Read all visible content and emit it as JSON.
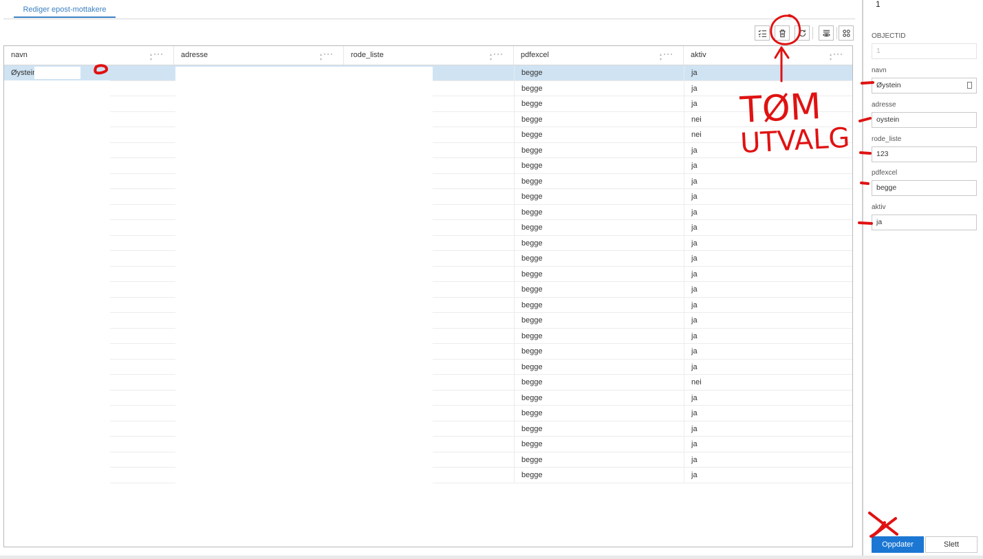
{
  "tab": {
    "label": "Rediger epost-mottakere"
  },
  "table": {
    "columns": [
      {
        "key": "navn",
        "label": "navn"
      },
      {
        "key": "adresse",
        "label": "adresse"
      },
      {
        "key": "rode_liste",
        "label": "rode_liste"
      },
      {
        "key": "pdfexcel",
        "label": "pdfexcel"
      },
      {
        "key": "aktiv",
        "label": "aktiv"
      }
    ],
    "rows": [
      {
        "navn": "Øystein",
        "pdfexcel": "begge",
        "aktiv": "ja"
      },
      {
        "navn": "",
        "pdfexcel": "begge",
        "aktiv": "ja"
      },
      {
        "navn": "",
        "pdfexcel": "begge",
        "aktiv": "ja"
      },
      {
        "navn": "",
        "pdfexcel": "begge",
        "aktiv": "nei"
      },
      {
        "navn": "",
        "pdfexcel": "begge",
        "aktiv": "nei"
      },
      {
        "navn": "",
        "pdfexcel": "begge",
        "aktiv": "ja"
      },
      {
        "navn": "",
        "pdfexcel": "begge",
        "aktiv": "ja"
      },
      {
        "navn": "",
        "pdfexcel": "begge",
        "aktiv": "ja"
      },
      {
        "navn": "",
        "pdfexcel": "begge",
        "aktiv": "ja"
      },
      {
        "navn": "",
        "pdfexcel": "begge",
        "aktiv": "ja"
      },
      {
        "navn": "",
        "pdfexcel": "begge",
        "aktiv": "ja"
      },
      {
        "navn": "",
        "pdfexcel": "begge",
        "aktiv": "ja"
      },
      {
        "navn": "",
        "pdfexcel": "begge",
        "aktiv": "ja"
      },
      {
        "navn": "",
        "pdfexcel": "begge",
        "aktiv": "ja"
      },
      {
        "navn": "",
        "pdfexcel": "begge",
        "aktiv": "ja"
      },
      {
        "navn": "",
        "pdfexcel": "begge",
        "aktiv": "ja"
      },
      {
        "navn": "",
        "pdfexcel": "begge",
        "aktiv": "ja"
      },
      {
        "navn": "",
        "pdfexcel": "begge",
        "aktiv": "ja"
      },
      {
        "navn": "",
        "pdfexcel": "begge",
        "aktiv": "ja"
      },
      {
        "navn": "",
        "pdfexcel": "begge",
        "aktiv": "ja"
      },
      {
        "navn": "",
        "pdfexcel": "begge",
        "aktiv": "nei"
      },
      {
        "navn": "",
        "pdfexcel": "begge",
        "aktiv": "ja"
      },
      {
        "navn": "",
        "pdfexcel": "begge",
        "aktiv": "ja"
      },
      {
        "navn": "",
        "pdfexcel": "begge",
        "aktiv": "ja"
      },
      {
        "navn": "",
        "pdfexcel": "begge",
        "aktiv": "ja"
      },
      {
        "navn": "",
        "pdfexcel": "begge",
        "aktiv": "ja"
      },
      {
        "navn": "",
        "pdfexcel": "begge",
        "aktiv": "ja"
      }
    ]
  },
  "toolbar": {
    "icons": [
      "checklist-icon",
      "trash-icon",
      "refresh-icon",
      "show-hide-icon",
      "grid-icon"
    ]
  },
  "panel": {
    "count": "1",
    "fields": [
      {
        "label": "OBJECTID",
        "value": "1",
        "disabled": true
      },
      {
        "label": "navn",
        "value": "Øystein"
      },
      {
        "label": "adresse",
        "value": "oystein"
      },
      {
        "label": "rode_liste",
        "value": "123"
      },
      {
        "label": "pdfexcel",
        "value": "begge"
      },
      {
        "label": "aktiv",
        "value": "ja"
      }
    ],
    "update_label": "Oppdater",
    "delete_label": "Slett"
  },
  "annotation": {
    "line1": "TØM",
    "line2": "UTVALG",
    "color": "#e01212"
  },
  "colors": {
    "accent": "#1b77d3",
    "selected_row": "#cfe3f3",
    "tab": "#3a7fc1"
  }
}
